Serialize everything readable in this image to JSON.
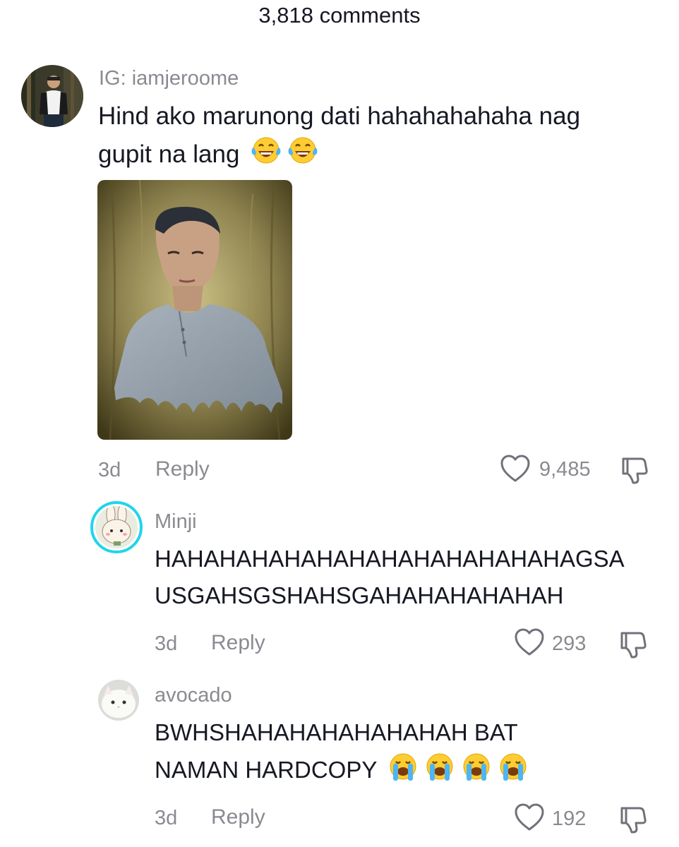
{
  "header": {
    "title": "3,818 comments"
  },
  "comments": [
    {
      "username": "IG: iamjeroome",
      "text_line1": "Hind ako marunong dati hahahahahaha nag",
      "text_line2": "gupit na lang",
      "emojis": [
        "face-with-tears-of-joy",
        "face-with-tears-of-joy"
      ],
      "time": "3d",
      "reply_label": "Reply",
      "likes": "9,485"
    },
    {
      "username": "Minji",
      "text_line1": "HAHAHAHAHAHAHAHAHAHAHAHAHAGSA",
      "text_line2": "USGAHSGSHAHSGAHAHAHAHAHAH",
      "time": "3d",
      "reply_label": "Reply",
      "likes": "293"
    },
    {
      "username": "avocado",
      "text_line1": "BWHSHAHAHAHAHAHAHAH BAT",
      "text_line2": "NAMAN HARDCOPY",
      "emojis": [
        "loudly-crying-face",
        "loudly-crying-face",
        "loudly-crying-face",
        "loudly-crying-face"
      ],
      "time": "3d",
      "reply_label": "Reply",
      "likes": "192"
    }
  ],
  "colors": {
    "primary_text": "#161823",
    "secondary_text": "#8a8b91",
    "story_ring": "#20d5ec"
  }
}
